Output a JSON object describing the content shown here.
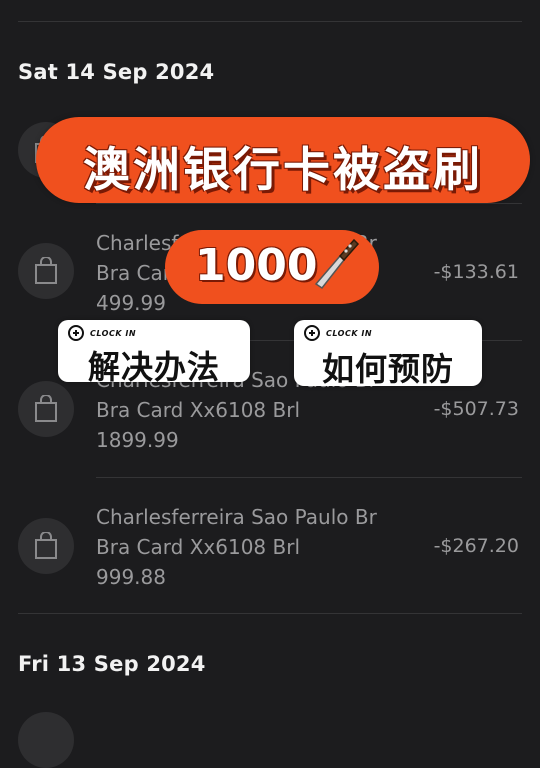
{
  "sections": [
    {
      "date": "Sat 14 Sep 2024",
      "transactions": [
        {
          "line1": "",
          "line2": "",
          "line3": "",
          "amount": ""
        },
        {
          "line1": "Charlesferreira Sao Paulo Br",
          "line2": "Bra Card Xx6108 Brl",
          "line3": "499.99",
          "amount": "-$133.61"
        },
        {
          "line1": "Charlesferreira Sao Paulo Br",
          "line2": "Bra Card Xx6108 Brl",
          "line3": "1899.99",
          "amount": "-$507.73"
        },
        {
          "line1": "Charlesferreira Sao Paulo Br",
          "line2": "Bra Card Xx6108 Brl",
          "line3": "999.88",
          "amount": "-$267.20"
        }
      ]
    },
    {
      "date": "Fri 13 Sep 2024",
      "transactions": []
    }
  ],
  "overlay": {
    "banner": "澳洲银行卡被盗刷",
    "amount_pill": "1000",
    "sticker_left": {
      "tag": "CLOCK IN",
      "text": "解决办法"
    },
    "sticker_right": {
      "tag": "CLOCK IN",
      "text": "如何预防"
    },
    "accent_color": "#f0501e"
  },
  "icons": {
    "transaction": "shopping-bag-icon",
    "amount_pill": "knife-icon",
    "sticker": "plus-circle-icon"
  }
}
